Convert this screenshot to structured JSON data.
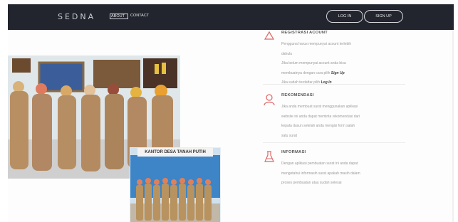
{
  "navbar": {
    "brand": "SEDNA",
    "links": [
      "ABOUT",
      "CONTACT"
    ],
    "login_label": "LOG IN",
    "signup_label": "SIGN UP"
  },
  "inset_photo": {
    "sign_text": "KANTOR DESA TANAH PUTIH"
  },
  "features": [
    {
      "title": "REGISTRASI ACOUNT",
      "icon": "recycle-icon",
      "lines": [
        "Pengguna harus mempunyai acount terlebih",
        "dahulu",
        "Jika belum mempunyai acount anda bisa"
      ],
      "line4_prefix": "membuatnya dengan cara pilih ",
      "line4_link": "Sign Up",
      "line5_prefix": "Jika sudah terdaftar pilih ",
      "line5_link": "Log In"
    },
    {
      "title": "REKOMENDASI",
      "icon": "user-icon",
      "lines": [
        "Jika anda membuat surat menggunakan aplikasi",
        "website ini anda dapat meminta rekomendasi dari",
        "kepala dusun setelah anda mengisi form salah",
        "satu surat"
      ]
    },
    {
      "title": "INFORMASI",
      "icon": "flask-icon",
      "lines": [
        "Dengan aplikasi pembuatan surat ini anda dapat",
        "mengetahui informasih surat apakah masih dalam",
        "proses pembuatan atau sudah selesai"
      ]
    }
  ],
  "colors": {
    "navbar": "#22252e",
    "accent": "#e06666",
    "brand_mid": "#7fa7ce"
  }
}
